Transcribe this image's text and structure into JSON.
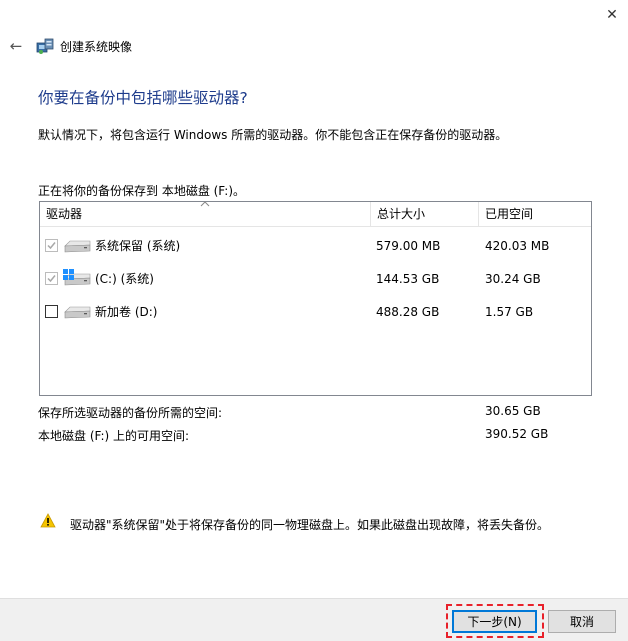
{
  "window": {
    "title": "创建系统映像",
    "close_glyph": "✕",
    "back_glyph": "←"
  },
  "heading": "你要在备份中包括哪些驱动器?",
  "description": "默认情况下，将包含运行 Windows 所需的驱动器。你不能包含正在保存备份的驱动器。",
  "save_to": "正在将你的备份保存到 本地磁盘 (F:)。",
  "table": {
    "headers": {
      "drive": "驱动器",
      "total": "总计大小",
      "used": "已用空间"
    },
    "rows": [
      {
        "name": "系统保留 (系统)",
        "total": "579.00 MB",
        "used": "420.03 MB",
        "checked": true,
        "disabled": true,
        "icon": "drive-icon"
      },
      {
        "name": "(C:) (系统)",
        "total": "144.53 GB",
        "used": "30.24 GB",
        "checked": true,
        "disabled": true,
        "icon": "windows-drive-icon"
      },
      {
        "name": "新加卷 (D:)",
        "total": "488.28 GB",
        "used": "1.57 GB",
        "checked": false,
        "disabled": false,
        "icon": "drive-icon"
      }
    ]
  },
  "summary": {
    "required_label": "保存所选驱动器的备份所需的空间:",
    "required_value": "30.65 GB",
    "available_label": "本地磁盘 (F:) 上的可用空间:",
    "available_value": "390.52 GB"
  },
  "warning": "驱动器\"系统保留\"处于将保存备份的同一物理磁盘上。如果此磁盘出现故障，将丢失备份。",
  "buttons": {
    "next": "下一步(N)",
    "cancel": "取消"
  },
  "colors": {
    "heading": "#1e3c8c",
    "highlight": "#e8212a",
    "focus": "#0078d7"
  }
}
